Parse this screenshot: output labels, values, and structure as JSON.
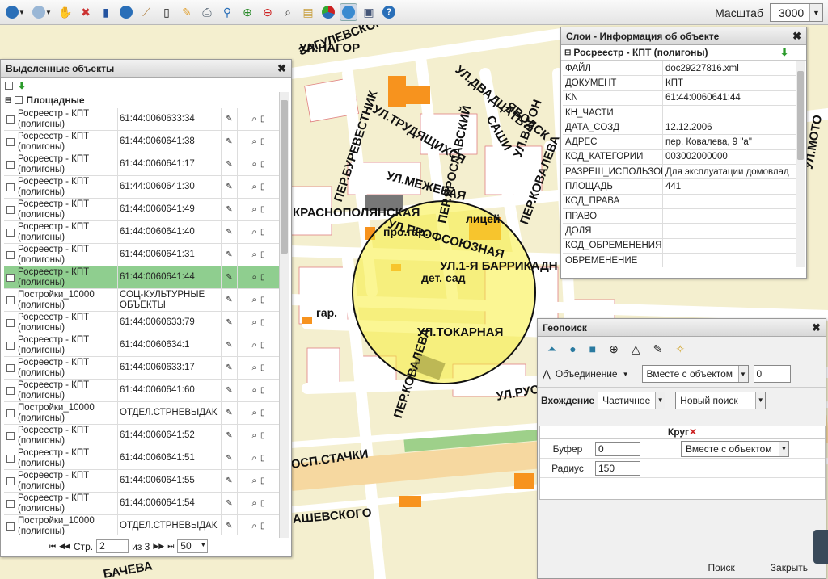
{
  "toolbar": {
    "icons": [
      "back-icon",
      "forward-icon",
      "hand-icon",
      "clear-selection-icon",
      "layers-icon",
      "info-icon",
      "ruler-icon",
      "mobile-icon",
      "pencil-icon",
      "print-icon",
      "location-pin-icon",
      "zoom-extent-icon",
      "zoom-out-icon",
      "search-icon",
      "book-icon",
      "chart-icon",
      "globe-icon",
      "image-icon",
      "help-icon"
    ],
    "scale_label": "Масштаб",
    "scale_value": "3000"
  },
  "map": {
    "labels": {
      "nagorn": "УЛ.НАГОР",
      "zagulevsk": "ЗАГУЛЕВСКОГ",
      "burevestnik": "ПЕР.БУРЕВЕСТНИК",
      "trudyash": "УЛ.ТРУДЯЩИХСЯ",
      "yaroslav": "ПЕР.ЯРОСЛАВСКИЙ",
      "dvadtsat": "УЛ.ДВАДЦАТЬ",
      "yavodsk": "ЯВОДСК",
      "sashi": "САШИ",
      "vagon": "УЛ.ВАГОН",
      "kovaleva_top": "ПЕР.КОВАЛЕВА",
      "mezhevaya": "УЛ.МЕЖЕВАЯ",
      "krasnopol": "КРАСНОПОЛЯНСКАЯ",
      "profsoyuz": "УЛ.ПРОФСОЮЗНАЯ",
      "pro_gar": "про.гар.",
      "litsey": "лицей",
      "barrikad": "УЛ.1-Я БАРРИКАДН",
      "det_sad": "дет. сад",
      "gar": "гар.",
      "tokarnaya": "УЛ.ТОКАРНАЯ",
      "kovaleva": "ПЕР.КОВАЛЕВА",
      "rus": "УЛ.РУС",
      "stachki": "ОСП.СТАЧКИ",
      "ashevsk": "АШЕВСКОГО",
      "bacheva": "БАЧЕВА",
      "moto": "УЛ.МОТО"
    }
  },
  "selected": {
    "title": "Выделенные объекты",
    "group_label": "Площадные",
    "rows": [
      {
        "layer": "Росреестр - КПТ (полигоны)",
        "value": "61:44:0060633:34"
      },
      {
        "layer": "Росреестр - КПТ (полигоны)",
        "value": "61:44:0060641:38"
      },
      {
        "layer": "Росреестр - КПТ (полигоны)",
        "value": "61:44:0060641:17"
      },
      {
        "layer": "Росреестр - КПТ (полигоны)",
        "value": "61:44:0060641:30"
      },
      {
        "layer": "Росреестр - КПТ (полигоны)",
        "value": "61:44:0060641:49"
      },
      {
        "layer": "Росреестр - КПТ (полигоны)",
        "value": "61:44:0060641:40"
      },
      {
        "layer": "Росреестр - КПТ (полигоны)",
        "value": "61:44:0060641:31"
      },
      {
        "layer": "Росреестр - КПТ (полигоны)",
        "value": "61:44:0060641:44"
      },
      {
        "layer": "Постройки_10000 (полигоны)",
        "value": "СОЦ-КУЛЬТУРНЫЕ ОБЪЕКТЫ"
      },
      {
        "layer": "Росреестр - КПТ (полигоны)",
        "value": "61:44:0060633:79"
      },
      {
        "layer": "Росреестр - КПТ (полигоны)",
        "value": "61:44:0060634:1"
      },
      {
        "layer": "Росреестр - КПТ (полигоны)",
        "value": "61:44:0060633:17"
      },
      {
        "layer": "Росреестр - КПТ (полигоны)",
        "value": "61:44:0060641:60"
      },
      {
        "layer": "Постройки_10000 (полигоны)",
        "value": "ОТДЕЛ.СТРНЕВЫДАК"
      },
      {
        "layer": "Росреестр - КПТ (полигоны)",
        "value": "61:44:0060641:52"
      },
      {
        "layer": "Росреестр - КПТ (полигоны)",
        "value": "61:44:0060641:51"
      },
      {
        "layer": "Росреестр - КПТ (полигоны)",
        "value": "61:44:0060641:55"
      },
      {
        "layer": "Росреестр - КПТ (полигоны)",
        "value": "61:44:0060641:54"
      },
      {
        "layer": "Постройки_10000 (полигоны)",
        "value": "ОТДЕЛ.СТРНЕВЫДАК"
      }
    ],
    "pager": {
      "page_label": "Стр.",
      "page": "2",
      "of_label": "из 3",
      "per_page": "50"
    }
  },
  "info": {
    "title": "Слои - Информация об объекте",
    "layer_name": "Росреестр - КПТ (полигоны)",
    "fields": [
      {
        "key": "ФАЙЛ",
        "value": "doc29227816.xml"
      },
      {
        "key": "ДОКУМЕНТ",
        "value": "КПТ"
      },
      {
        "key": "KN",
        "value": "61:44:0060641:44"
      },
      {
        "key": "КН_ЧАСТИ",
        "value": ""
      },
      {
        "key": "ДАТА_СОЗД",
        "value": "12.12.2006"
      },
      {
        "key": "АДРЕС",
        "value": "пер. Ковалева, 9 \"а\""
      },
      {
        "key": "КОД_КАТЕГОРИИ",
        "value": "003002000000"
      },
      {
        "key": "РАЗРЕШ_ИСПОЛЬЗОВ",
        "value": "Для эксплуатации домовлад"
      },
      {
        "key": "ПЛОЩАДЬ",
        "value": "441"
      },
      {
        "key": "КОД_ПРАВА",
        "value": ""
      },
      {
        "key": "ПРАВО",
        "value": ""
      },
      {
        "key": "ДОЛЯ",
        "value": ""
      },
      {
        "key": "КОД_ОБРЕМЕНЕНИЯ",
        "value": ""
      },
      {
        "key": "ОБРЕМЕНЕНИЕ",
        "value": ""
      }
    ]
  },
  "geo": {
    "title": "Геопоиск",
    "union_label": "Объединение",
    "union_mode": "Вместе с объектом",
    "union_value": "0",
    "occurrence_label": "Вхождение",
    "occurrence_value": "Частичное",
    "search_mode": "Новый поиск",
    "circle_title": "Круг",
    "buffer_label": "Буфер",
    "buffer_value": "0",
    "buffer_mode": "Вместе с объектом",
    "radius_label": "Радиус",
    "radius_value": "150",
    "search_button": "Поиск",
    "close_button": "Закрыть"
  }
}
